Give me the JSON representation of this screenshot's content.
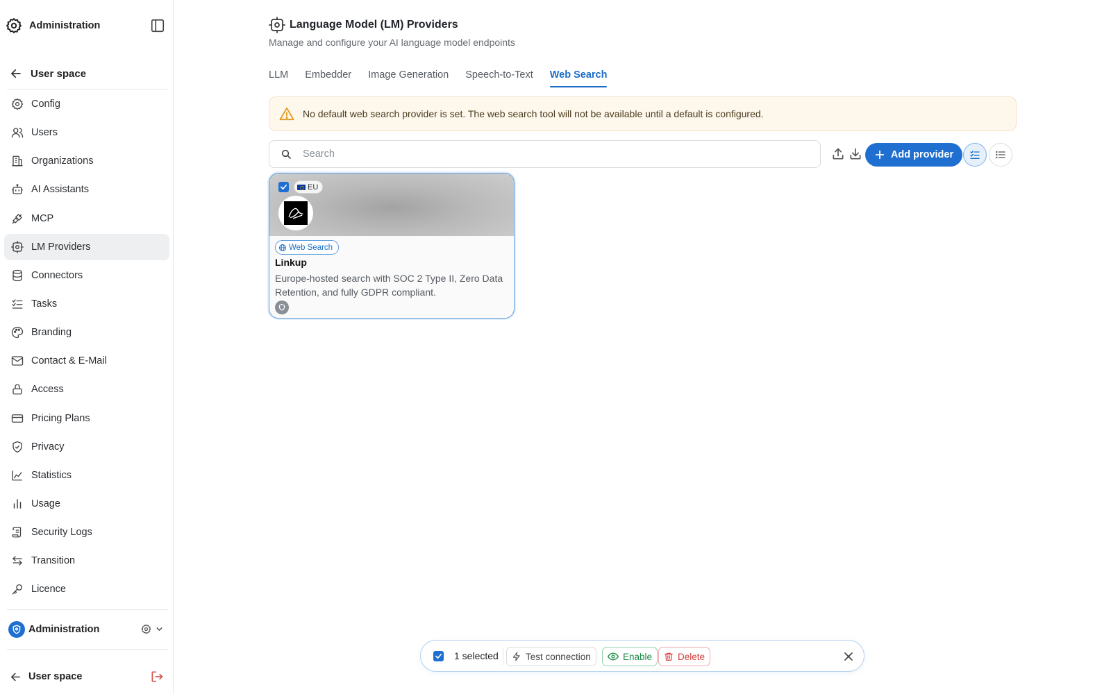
{
  "sidebar": {
    "header_title": "Administration",
    "back_label": "User space",
    "items": [
      {
        "label": "Config",
        "icon": "gear-icon"
      },
      {
        "label": "Users",
        "icon": "users-icon"
      },
      {
        "label": "Organizations",
        "icon": "building-icon"
      },
      {
        "label": "AI Assistants",
        "icon": "bot-icon"
      },
      {
        "label": "MCP",
        "icon": "plug-icon"
      },
      {
        "label": "LM Providers",
        "icon": "cpu-icon",
        "active": true
      },
      {
        "label": "Connectors",
        "icon": "database-icon"
      },
      {
        "label": "Tasks",
        "icon": "list-check-icon"
      },
      {
        "label": "Branding",
        "icon": "palette-icon"
      },
      {
        "label": "Contact & E-Mail",
        "icon": "mail-icon"
      },
      {
        "label": "Access",
        "icon": "lock-icon"
      },
      {
        "label": "Pricing Plans",
        "icon": "credit-card-icon"
      },
      {
        "label": "Privacy",
        "icon": "shield-check-icon"
      },
      {
        "label": "Statistics",
        "icon": "area-chart-icon"
      },
      {
        "label": "Usage",
        "icon": "bar-chart-icon"
      },
      {
        "label": "Security Logs",
        "icon": "scroll-icon"
      },
      {
        "label": "Transition",
        "icon": "arrows-swap-icon"
      },
      {
        "label": "Licence",
        "icon": "key-icon"
      }
    ],
    "org_label": "Administration",
    "footer_label": "User space"
  },
  "page": {
    "title": "Language Model (LM) Providers",
    "subtitle": "Manage and configure your AI language model endpoints"
  },
  "tabs": [
    {
      "label": "LLM"
    },
    {
      "label": "Embedder"
    },
    {
      "label": "Image Generation"
    },
    {
      "label": "Speech-to-Text"
    },
    {
      "label": "Web Search",
      "active": true
    }
  ],
  "alert": {
    "text": "No default web search provider is set. The web search tool will not be available until a default is configured.",
    "color": "#fdf7ec"
  },
  "search": {
    "placeholder": "Search",
    "value": ""
  },
  "toolbar": {
    "add_label": "Add provider",
    "accent": "#1f6fd1"
  },
  "providers": [
    {
      "name": "Linkup",
      "region": "EU",
      "tag": "Web Search",
      "description": "Europe-hosted search with SOC 2 Type II, Zero Data Retention, and fully GDPR compliant.",
      "selected": true
    }
  ],
  "bulk": {
    "count_label": "1 selected",
    "test_label": "Test connection",
    "enable_label": "Enable",
    "delete_label": "Delete"
  }
}
